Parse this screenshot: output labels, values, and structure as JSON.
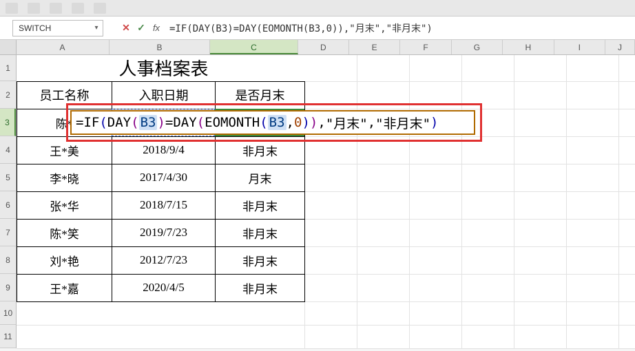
{
  "name_box": {
    "value": "SWITCH"
  },
  "formula_bar": {
    "text": "=IF(DAY(B3)=DAY(EOMONTH(B3,0)),\"月末\",\"非月末\")"
  },
  "columns": [
    "A",
    "B",
    "C",
    "D",
    "E",
    "F",
    "G",
    "H",
    "I",
    "J"
  ],
  "selected_col": "C",
  "selected_row": 3,
  "row_labels": [
    1,
    2,
    3,
    4,
    5,
    6,
    7,
    8,
    9,
    10,
    11
  ],
  "title": "人事档案表",
  "headers": {
    "name": "员工名称",
    "date": "入职日期",
    "eom": "是否月末"
  },
  "rows": [
    {
      "name": "陈*",
      "date": "",
      "eom": ""
    },
    {
      "name": "王*美",
      "date": "2018/9/4",
      "eom": "非月末"
    },
    {
      "name": "李*晓",
      "date": "2017/4/30",
      "eom": "月末"
    },
    {
      "name": "张*华",
      "date": "2018/7/15",
      "eom": "非月末"
    },
    {
      "name": "陈*笑",
      "date": "2019/7/23",
      "eom": "非月末"
    },
    {
      "name": "刘*艳",
      "date": "2012/7/23",
      "eom": "非月末"
    },
    {
      "name": "王*嘉",
      "date": "2020/4/5",
      "eom": "非月末"
    }
  ],
  "editor": {
    "tokens": [
      {
        "cls": "tok-eq",
        "t": "=IF"
      },
      {
        "cls": "tok-p1",
        "t": "("
      },
      {
        "cls": "tok-fn",
        "t": "DAY"
      },
      {
        "cls": "tok-p2",
        "t": "("
      },
      {
        "cls": "tok-ref",
        "t": "B3"
      },
      {
        "cls": "tok-p2",
        "t": ")"
      },
      {
        "cls": "tok-fn",
        "t": "=DAY"
      },
      {
        "cls": "tok-p2",
        "t": "("
      },
      {
        "cls": "tok-fn",
        "t": "EOMONTH"
      },
      {
        "cls": "tok-p1",
        "t": "("
      },
      {
        "cls": "tok-ref",
        "t": "B3"
      },
      {
        "cls": "tok-fn",
        "t": ","
      },
      {
        "cls": "tok-num",
        "t": "0"
      },
      {
        "cls": "tok-p1",
        "t": ")"
      },
      {
        "cls": "tok-p2",
        "t": ")"
      },
      {
        "cls": "tok-fn",
        "t": ","
      },
      {
        "cls": "tok-str",
        "t": "\"月末\""
      },
      {
        "cls": "tok-fn",
        "t": ","
      },
      {
        "cls": "tok-str",
        "t": "\"非月末\""
      },
      {
        "cls": "tok-p1",
        "t": ")"
      }
    ]
  },
  "icons": {
    "chevron_down": "▾",
    "cancel": "✕",
    "enter": "✓",
    "fx": "fx"
  }
}
